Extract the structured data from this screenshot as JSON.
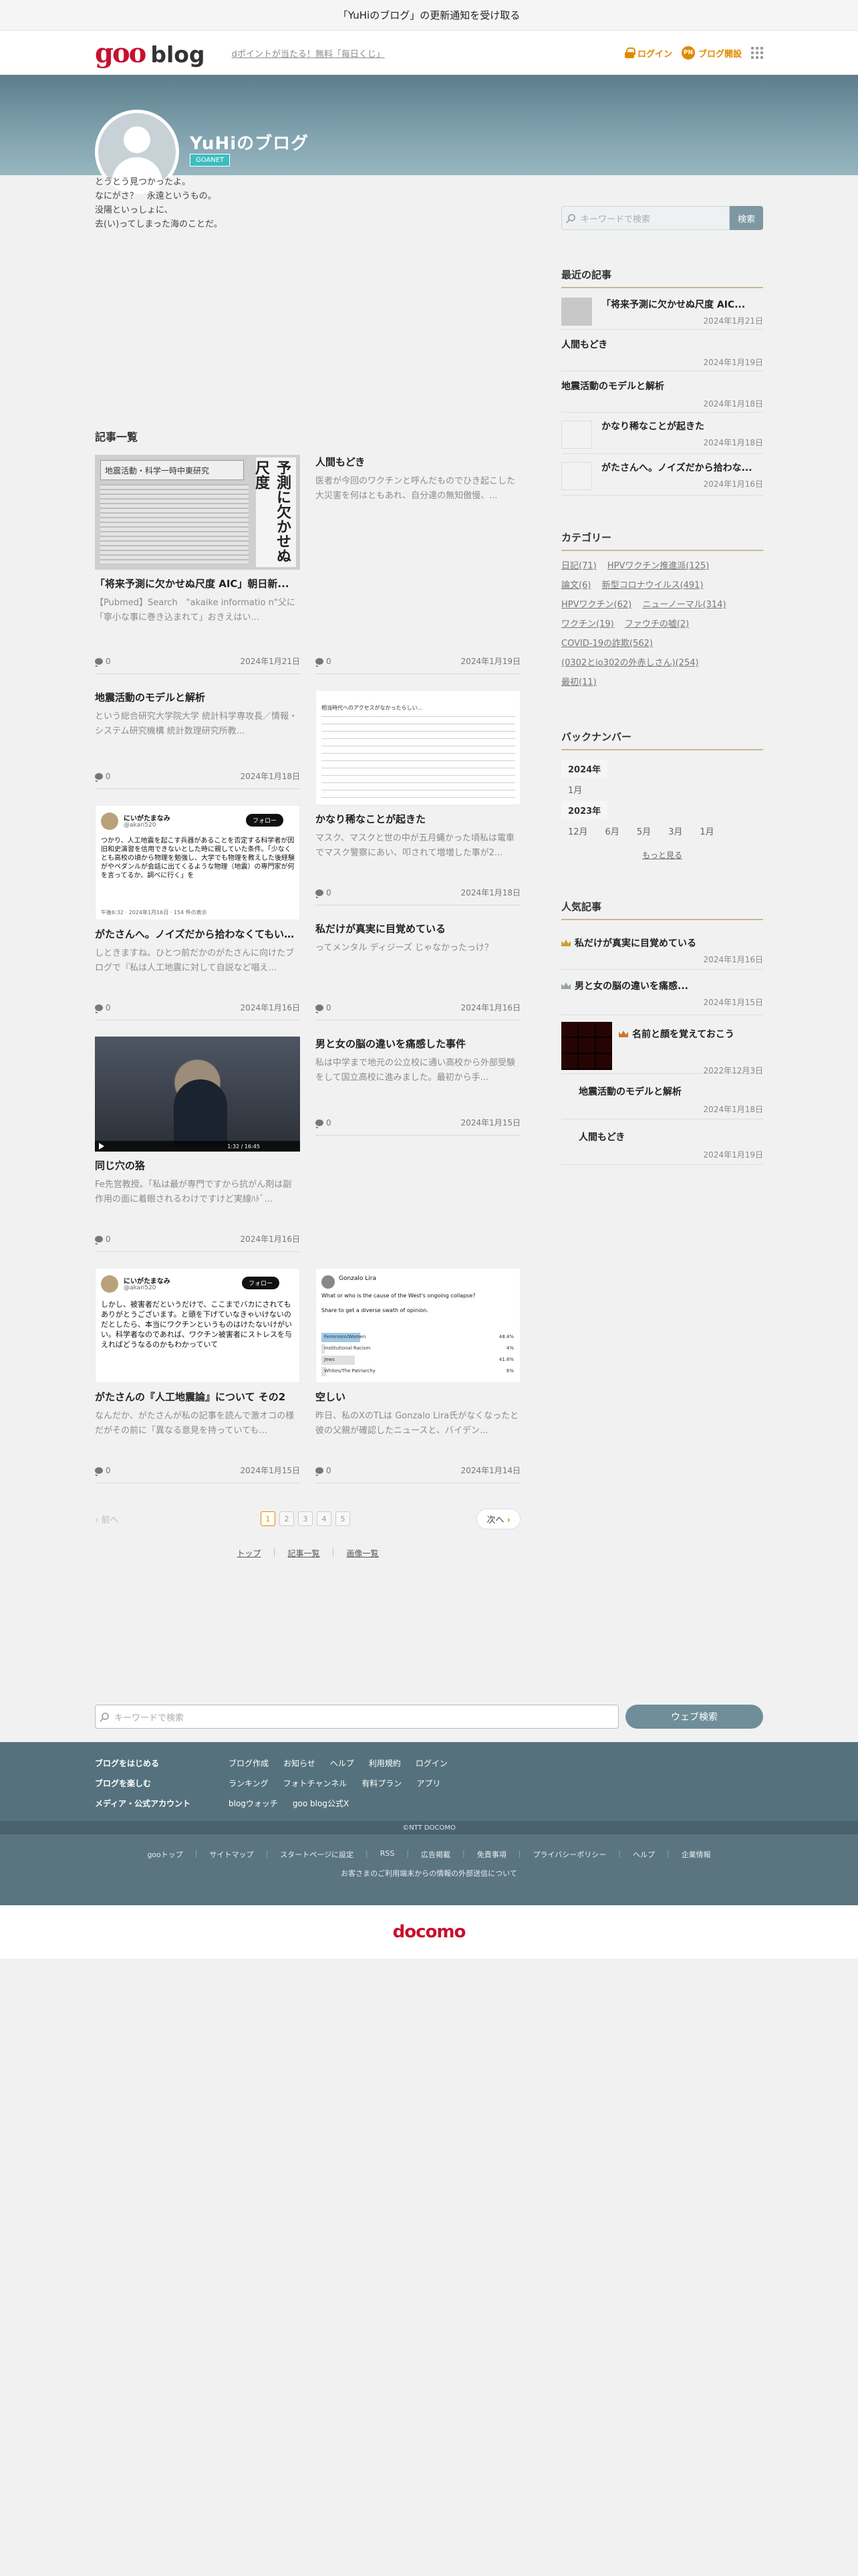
{
  "notice": "「YuHiのブログ」の更新通知を受け取る",
  "header": {
    "logo_goo": "goo",
    "logo_blog": "blog",
    "promo": "dポイントが当たる！無料「毎日くじ」",
    "login": "ログイン",
    "register": "ブログ開設",
    "pen_text": "PN"
  },
  "profile": {
    "title": "YuHiのブログ",
    "badge": "GOANET",
    "intro": [
      "とうとう見つかったよ。",
      "なにがさ？　永遠というもの。",
      "没陽といっしょに、",
      "去(い)ってしまった海のことだ。"
    ]
  },
  "articles_heading": "記事一覧",
  "posts": [
    {
      "title": "「将来予測に欠かせぬ尺度 AIC」朝日新...",
      "excerpt": "【Pubmed】Search　\"akaike informatio n\"父に「寧小な事に巻き込まれて」おきえはい...",
      "comments": "0",
      "date": "2024年1月21日"
    },
    {
      "title": "人間もどき",
      "excerpt": "医者が今回のワクチンと呼んだものでひき起こした大災害を何はともあれ、自分達の無知傲慢、...",
      "comments": "0",
      "date": "2024年1月19日"
    },
    {
      "title": "地震活動のモデルと解析",
      "excerpt": "という総合研究大学院大学 統計科学専攻長／情報・システム研究機構 統計数理研究所教...",
      "comments": "0",
      "date": "2024年1月18日"
    },
    {
      "title": "かなり稀なことが起きた",
      "excerpt": "マスク、マスクと世の中が五月蝿かった頃私は電車でマスク警察にあい、叩されて増増した事が2...",
      "comments": "0",
      "date": "2024年1月18日"
    },
    {
      "title": "がたさんへ。ノイズだから拾わなくてもいい...",
      "excerpt": "しときますね。ひとつ前だかのがたさんに向けたブログで『私は人工地震に対して自説など唱え...",
      "comments": "0",
      "date": "2024年1月16日"
    },
    {
      "title": "私だけが真実に目覚めている",
      "excerpt": "ってメンタル ディジーズ じゃなかったっけ？",
      "comments": "0",
      "date": "2024年1月16日"
    },
    {
      "title": "同じ穴の狢",
      "excerpt": "Fe先営教授。｢私は最が専門ですから抗がん剤は副作用の面に着眼されるわけですけど実線ﾊﾄﾞ...",
      "comments": "0",
      "date": "2024年1月16日"
    },
    {
      "title": "男と女の脳の違いを痛感した事件",
      "excerpt": "私は中学まで地元の公立校に通い高校から外部受験をして国立高校に進みました。最初から手...",
      "comments": "0",
      "date": "2024年1月15日"
    },
    {
      "title": "がたさんの『人工地震論』について その2",
      "excerpt": "なんだか、がたさんが私の記事を読んで激オコの様だがその前に「異なる意見を持っていても...",
      "comments": "0",
      "date": "2024年1月15日"
    },
    {
      "title": "空しい",
      "excerpt": "昨日、私のXのTLは Gonzalo Lira氏がなくなったと彼の父親が確認したニュースと、バイデン...",
      "comments": "0",
      "date": "2024年1月14日"
    }
  ],
  "thumb_text": {
    "news_headline": "地震活動・科学一時中東研究",
    "news_side": "予測に欠かせぬ尺度",
    "tweet1_name": "にいがたまなみ",
    "tweet1_handle": "@akari520",
    "tweet1_follow": "フォロー",
    "tweet1_body": "つかり、人工地震を起こす兵器があることを否定する科学者が因旧和史演習を信用できないとした時に親していた条件。「少なくとも高校の頃から物理を勉強し、大学でも物理を教えした後経験がやペダンルが会話に出てくるような物理（地震）の専門家が何を言ってるか、調べに行く」を",
    "tweet1_time": "午後6:32 · 2024年1月16日 · 154 件の表示",
    "tweet2_name": "にいがたまなみ",
    "tweet2_handle": "@akari520",
    "tweet2_follow": "フォロー",
    "tweet2_body": "しかし、被害者だというだけで、ここまでバカにされてもありがとうございます。と頭を下げていなきゃいけないのだとしたら、本当にワクチンというものはけたないけがいい。科学者なのであれば、ワクチン被害者にストレスを与えればどうなるのかもわかっていて",
    "video_time": "1:32 / 16:45",
    "poll_name": "Gonzalo Lira",
    "poll_q": "What or who is the cause of the West's ongoing collapse?",
    "poll_sub": "Share to get a diverse swath of opinion.",
    "poll_opts": [
      "Feminism/Women",
      "Institutional Racism",
      "Jews",
      "Whites/The Patriarchy"
    ],
    "poll_pcts": [
      "48.4%",
      "4%",
      "41.8%",
      "6%"
    ],
    "note_text": "相当時代へのアクセスがなかったらしい..."
  },
  "pager": {
    "prev": "前へ",
    "pages": [
      "1",
      "2",
      "3",
      "4",
      "5"
    ],
    "next": "次へ"
  },
  "bottom_links": [
    "トップ",
    "記事一覧",
    "画像一覧"
  ],
  "side": {
    "search_placeholder": "キーワードで検索",
    "search_button": "検索",
    "recent_title": "最近の記事",
    "recent": [
      {
        "title": "「将来予測に欠かせぬ尺度 AIC...",
        "date": "2024年1月21日"
      },
      {
        "title": "人間もどき",
        "date": "2024年1月19日"
      },
      {
        "title": "地震活動のモデルと解析",
        "date": "2024年1月18日"
      },
      {
        "title": "かなり稀なことが起きた",
        "date": "2024年1月18日"
      },
      {
        "title": "がたさんへ。ノイズだから拾わな...",
        "date": "2024年1月16日"
      }
    ],
    "category_title": "カテゴリー",
    "categories": [
      "日記(71)",
      "HPVワクチン推進派(125)",
      "論文(6)",
      "新型コロナウイルス(491)",
      "HPVワクチン(62)",
      "ニューノーマル(314)",
      "ワクチン(19)",
      "ファウチの嘘(2)",
      "COVID-19の詐欺(562)",
      "(0302とio302の外赤しさん)(254)",
      "最初(11)"
    ],
    "backnumber_title": "バックナンバー",
    "year1": "2024年",
    "months1": [
      "1月"
    ],
    "year2": "2023年",
    "months2": [
      "12月",
      "6月",
      "5月",
      "3月",
      "1月"
    ],
    "more": "もっと見る",
    "popular_title": "人気記事",
    "popular": [
      {
        "title": "私だけが真実に目覚めている",
        "date": "2024年1月16日"
      },
      {
        "title": "男と女の脳の違いを痛感...",
        "date": "2024年1月15日"
      },
      {
        "title": "名前と顔を覚えておこう",
        "date": "2022年12月3日"
      },
      {
        "title": "地震活動のモデルと解析",
        "date": "2024年1月18日"
      },
      {
        "title": "人間もどき",
        "date": "2024年1月19日"
      }
    ]
  },
  "footer": {
    "search_placeholder": "キーワードで検索",
    "search_button": "ウェブ検索",
    "row1_head": "ブログをはじめる",
    "row1": [
      "ブログ作成",
      "お知らせ",
      "ヘルプ",
      "利用規約",
      "ログイン"
    ],
    "row2_head": "ブログを楽しむ",
    "row2": [
      "ランキング",
      "フォトチャンネル",
      "有料プラン",
      "アプリ"
    ],
    "row3_head": "メディア・公式アカウント",
    "row3": [
      "blogウォッチ",
      "goo blog公式X"
    ],
    "copyright": "©NTT DOCOMO",
    "links": [
      "gooトップ",
      "サイトマップ",
      "スタートページに設定",
      "RSS",
      "広告掲載",
      "免責事項",
      "プライバシーポリシー",
      "ヘルプ",
      "企業情報"
    ],
    "external": "お客さまのご利用端末からの情報の外部送信について",
    "docomo": "docomo"
  }
}
